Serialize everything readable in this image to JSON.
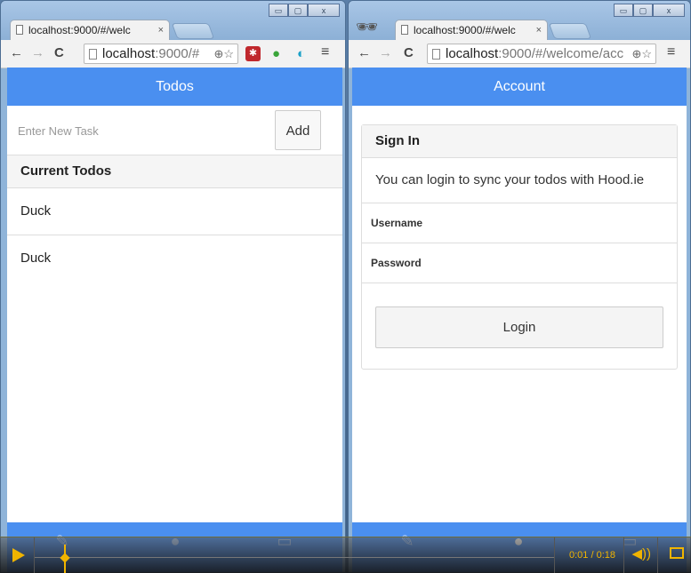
{
  "left_window": {
    "tab_title": "localhost:9000/#/welc",
    "tab_close": "×",
    "url_host": "localhost",
    "url_path": ":9000/#",
    "app_title": "Todos",
    "new_task_placeholder": "Enter New Task",
    "add_label": "Add",
    "list_header": "Current Todos",
    "todos": [
      "Duck",
      "Duck"
    ]
  },
  "right_window": {
    "tab_title": "localhost:9000/#/welc",
    "tab_close": "×",
    "url_host": "localhost",
    "url_path": ":9000/#/welcome/acc",
    "app_title": "Account",
    "card_title": "Sign In",
    "card_text": "You can login to sync your todos with Hood.ie",
    "username_label": "Username",
    "password_label": "Password",
    "login_label": "Login"
  },
  "browser": {
    "back": "←",
    "forward": "→",
    "reload": "C",
    "menu": "≡",
    "zoom_star": "⊕☆",
    "min": "▭",
    "max": "▢",
    "close": "x"
  },
  "player": {
    "time": "0:01 / 0:18",
    "progress": 0.056,
    "accent": "#f0b400"
  },
  "colors": {
    "app_bar": "#4a8ff0"
  },
  "icons": {
    "edit": "edit-icon",
    "user": "user-icon",
    "monitor": "monitor-icon",
    "incognito": "incognito-icon",
    "volume": "volume-icon",
    "fullscreen": "fullscreen-icon"
  }
}
